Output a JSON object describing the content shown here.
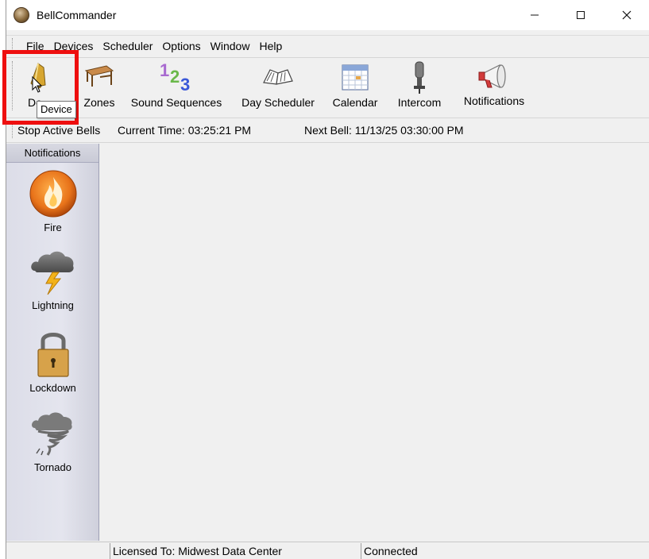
{
  "window": {
    "title": "BellCommander"
  },
  "menu": [
    "File",
    "Devices",
    "Scheduler",
    "Options",
    "Window",
    "Help"
  ],
  "toolbar": {
    "devices_label": "De",
    "zones_label": "Zones",
    "sequences_label": "Sound Sequences",
    "scheduler_label": "Day Scheduler",
    "calendar_label": "Calendar",
    "intercom_label": "Intercom",
    "notifications_label": "Notifications",
    "tooltip": "Device"
  },
  "info": {
    "stop_label": "Stop Active Bells",
    "current_time": "Current Time: 03:25:21 PM",
    "next_bell": "Next Bell: 11/13/25 03:30:00 PM"
  },
  "notifications": {
    "header": "Notifications",
    "items": [
      {
        "label": "Fire",
        "icon": "fire-icon"
      },
      {
        "label": "Lightning",
        "icon": "lightning-icon"
      },
      {
        "label": "Lockdown",
        "icon": "lock-icon"
      },
      {
        "label": "Tornado",
        "icon": "tornado-icon"
      }
    ]
  },
  "statusbar": {
    "license": "Licensed To: Midwest Data Center",
    "connection": "Connected"
  },
  "colors": {
    "highlight": "#ee0f0f",
    "panel": "#dcdde8",
    "client": "#f0f0f0"
  }
}
